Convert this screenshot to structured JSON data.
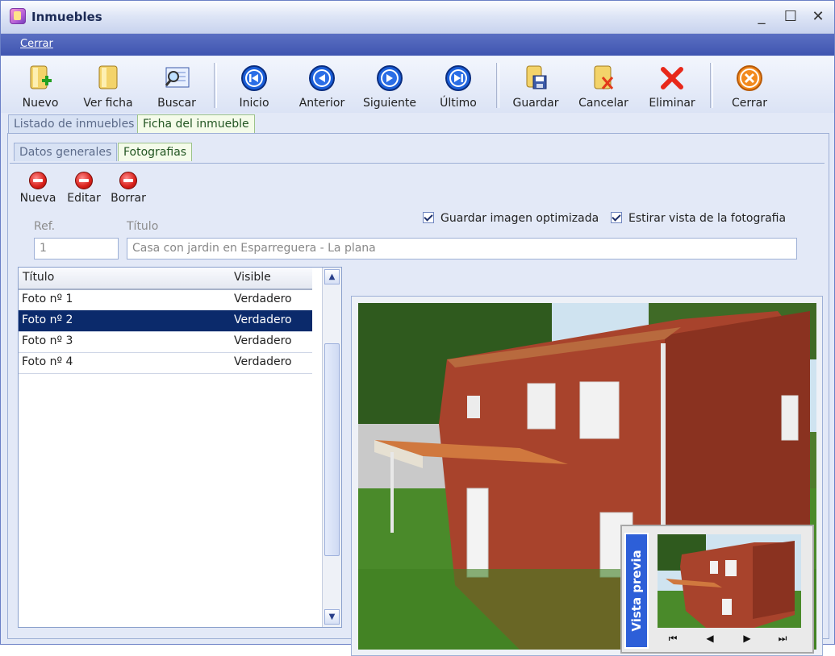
{
  "window": {
    "title": "Inmuebles",
    "controls": [
      "_",
      "☐",
      "✕"
    ]
  },
  "menu": {
    "items": [
      "Cerrar"
    ]
  },
  "toolbar": {
    "buttons": [
      {
        "label": "Nuevo",
        "icon": "new-document-icon"
      },
      {
        "label": "Ver ficha",
        "icon": "view-document-icon"
      },
      {
        "label": "Buscar",
        "icon": "search-icon"
      },
      {
        "label": "Inicio",
        "icon": "first-icon"
      },
      {
        "label": "Anterior",
        "icon": "previous-icon"
      },
      {
        "label": "Siguiente",
        "icon": "next-icon"
      },
      {
        "label": "Último",
        "icon": "last-icon"
      },
      {
        "label": "Guardar",
        "icon": "save-icon"
      },
      {
        "label": "Cancelar",
        "icon": "cancel-icon"
      },
      {
        "label": "Eliminar",
        "icon": "delete-icon"
      },
      {
        "label": "Cerrar",
        "icon": "close-icon"
      }
    ]
  },
  "main_tabs": [
    {
      "label": "Listado de inmuebles",
      "active": false
    },
    {
      "label": "Ficha del inmueble",
      "active": true
    }
  ],
  "sub_tabs": [
    {
      "label": "Datos generales",
      "active": false
    },
    {
      "label": "Fotografias",
      "active": true
    }
  ],
  "photo_actions": [
    {
      "label": "Nueva",
      "icon": "add-icon"
    },
    {
      "label": "Editar",
      "icon": "edit-icon"
    },
    {
      "label": "Borrar",
      "icon": "remove-icon"
    }
  ],
  "fields": {
    "ref_label": "Ref.",
    "ref_value": "1",
    "title_label": "Título",
    "title_value": "Casa con jardin en Esparreguera - La plana"
  },
  "options": {
    "save_optimized": {
      "label": "Guardar imagen optimizada",
      "checked": true
    },
    "stretch_view": {
      "label": "Estirar vista de la fotografia",
      "checked": true
    }
  },
  "photo_grid": {
    "columns": [
      "Título",
      "Visible"
    ],
    "rows": [
      {
        "title": "Foto nº 1",
        "visible": "Verdadero",
        "selected": false
      },
      {
        "title": "Foto nº 2",
        "visible": "Verdadero",
        "selected": true
      },
      {
        "title": "Foto nº 3",
        "visible": "Verdadero",
        "selected": false
      },
      {
        "title": "Foto nº 4",
        "visible": "Verdadero",
        "selected": false
      }
    ]
  },
  "preview": {
    "label": "Vista previa",
    "nav": [
      "⏮",
      "◀",
      "▶",
      "⏭"
    ]
  },
  "colors": {
    "menubar": "#3f55b0",
    "selected_row": "#0b2a6b",
    "active_tab": "#f4fbe9",
    "preview_tab": "#2d5fd8"
  }
}
